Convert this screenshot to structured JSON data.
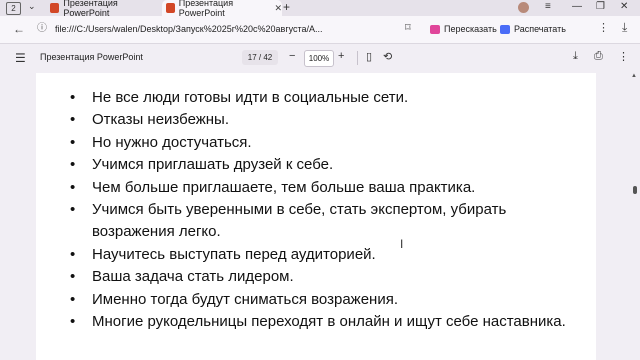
{
  "browser": {
    "tab_count": "2",
    "tabs": [
      {
        "title": "Презентация PowerPoint"
      },
      {
        "title": "Презентация PowerPoint"
      }
    ],
    "address": "file:///C:/Users/walen/Desktop/Запуск%2025г%20с%20августа/А...",
    "actions": {
      "retell": "Пересказать",
      "print": "Распечатать"
    }
  },
  "pdf_toolbar": {
    "title": "Презентация PowerPoint",
    "page": "17",
    "total_pages": "42",
    "page_indicator": "17 / 42",
    "zoom": "100%"
  },
  "slide": {
    "bullets": [
      "Не все люди готовы идти в социальные сети.",
      "Отказы неизбежны.",
      "Но нужно достучаться.",
      "Учимся приглашать друзей к себе.",
      "Чем больше приглашаете, тем больше ваша практика.",
      "Учимся быть уверенными в себе, стать экспертом, убирать возражения легко.",
      "Научитесь выступать перед аудиторией.",
      "Ваша задача стать лидером.",
      "Именно тогда будут сниматься возражения.",
      "Многие рукодельницы переходят в онлайн и ищут себе наставника."
    ]
  },
  "colors": {
    "ppt_icon": "#d24726",
    "retell_icon": "#e0459a",
    "print_icon": "#4a6cf7"
  }
}
